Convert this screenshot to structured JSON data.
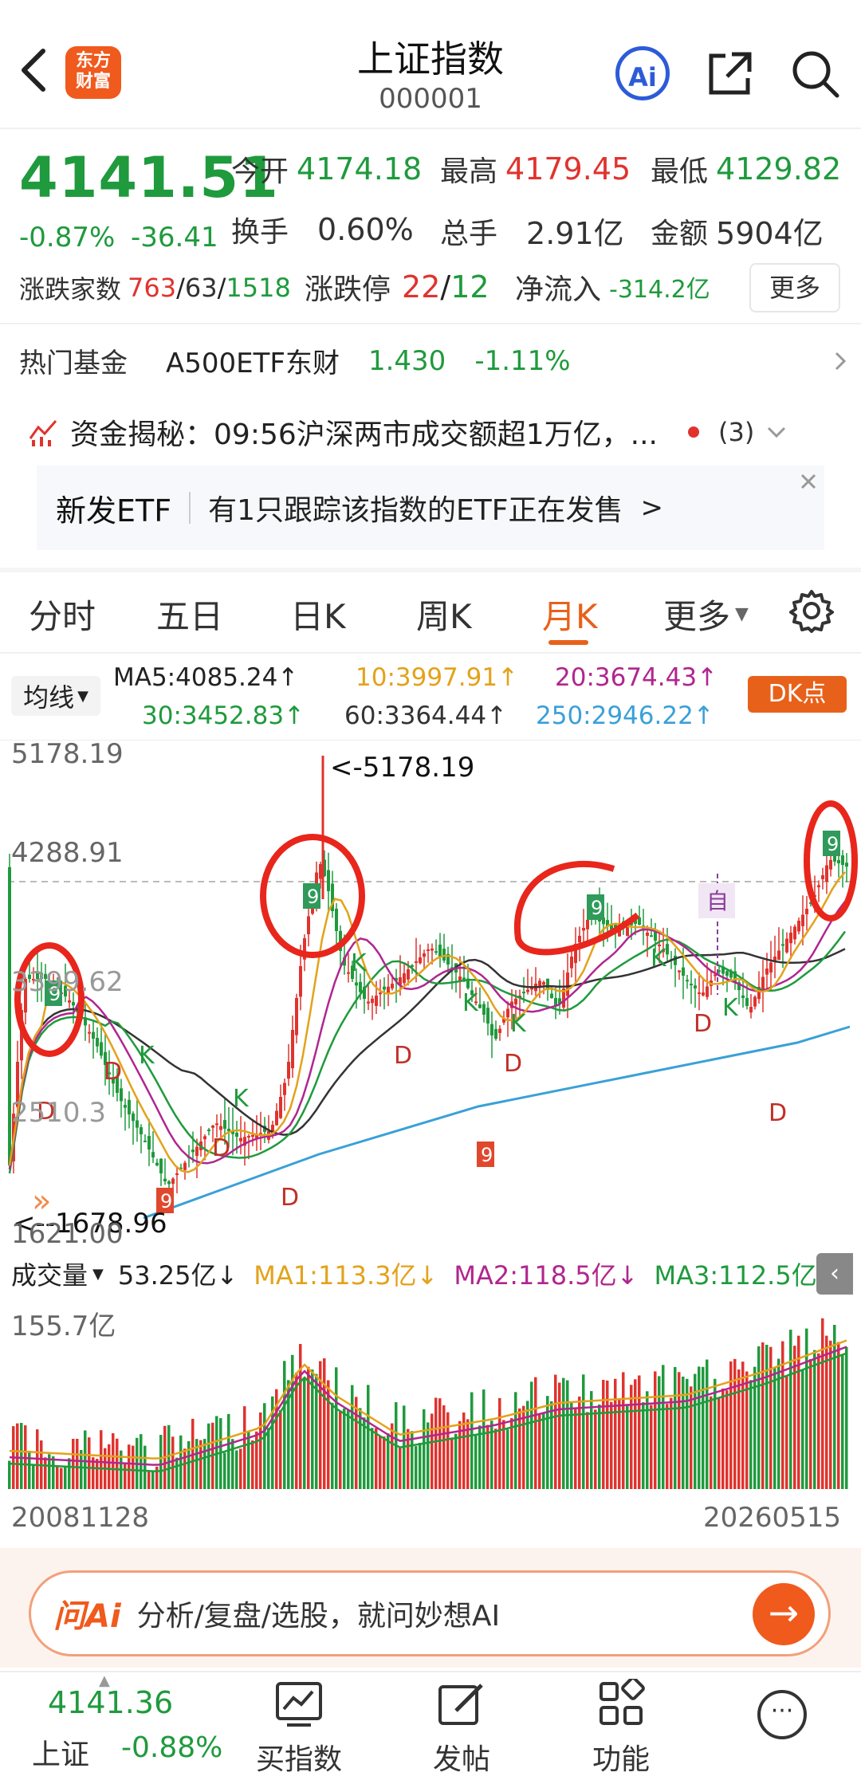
{
  "header": {
    "title": "上证指数",
    "code": "000001",
    "logo_line1": "东方",
    "logo_line2": "财富",
    "ai_label": "Ai"
  },
  "quote": {
    "price": "4141.51",
    "change_pct": "-0.87%",
    "change": "-36.41",
    "open_label": "今开",
    "open": "4174.18",
    "high_label": "最高",
    "high": "4179.45",
    "low_label": "最低",
    "low": "4129.82",
    "turnover_label": "换手",
    "turnover": "0.60%",
    "volume_label": "总手",
    "volume": "2.91亿",
    "amount_label": "金额",
    "amount": "5904亿",
    "adv_label": "涨跌家数",
    "adv_up": "763",
    "adv_flat": "63",
    "adv_down": "1518",
    "limit_label": "涨跌停",
    "limit_up": "22",
    "limit_down": "12",
    "inflow_label": "净流入",
    "inflow": "-314.2亿",
    "more_label": "更多"
  },
  "hot_fund": {
    "label": "热门基金",
    "name": "A500ETF东财",
    "price": "1.430",
    "pct": "-1.11%"
  },
  "news": {
    "label": "资金揭秘：",
    "text": "09:56沪深两市成交额超1万亿，...",
    "count": "(3)"
  },
  "etf_banner": {
    "tag": "新发ETF",
    "text": "有1只跟踪该指数的ETF正在发售",
    "arrow": ">"
  },
  "tabs": [
    "分时",
    "五日",
    "日K",
    "周K",
    "月K",
    "更多"
  ],
  "ma": {
    "selector": "均线",
    "ma5": "MA5:4085.24↑",
    "ma10": "10:3997.91↑",
    "ma20": "20:3674.43↑",
    "ma30": "30:3452.83↑",
    "ma60": "60:3364.44↑",
    "ma250": "250:2946.22↑",
    "dk": "DK点"
  },
  "chart_labels": {
    "y_top": "5178.19",
    "y_mid": "4288.91",
    "y_low": "3399.62",
    "y_low2": "2510.3",
    "y_bottom": "1621.00",
    "max_note": "<-5178.19",
    "min_note": "<--1678.96",
    "self_tag": "自"
  },
  "volume": {
    "label": "成交量",
    "value": "53.25亿↓",
    "ma1": "MA1:113.3亿↓",
    "ma2": "MA2:118.5亿↓",
    "ma3": "MA3:112.5亿↓",
    "y_top": "155.7亿",
    "date_start": "20081128",
    "date_end": "20260515"
  },
  "ask": {
    "brand": "问Ai",
    "placeholder": "分析/复盘/选股，就问妙想AI"
  },
  "bottom": {
    "index_price": "4141.36",
    "index_name": "上证",
    "index_pct": "-0.88%",
    "items": [
      "买指数",
      "发帖",
      "功能"
    ]
  },
  "colors": {
    "up": "#e0332e",
    "down": "#1f9a3d",
    "accent": "#e8611a",
    "ma5": "#222222",
    "ma10": "#e3a21a",
    "ma20": "#b0268f",
    "ma30": "#1f9a3d",
    "ma60": "#333333",
    "ma250": "#3aa0d8"
  }
}
